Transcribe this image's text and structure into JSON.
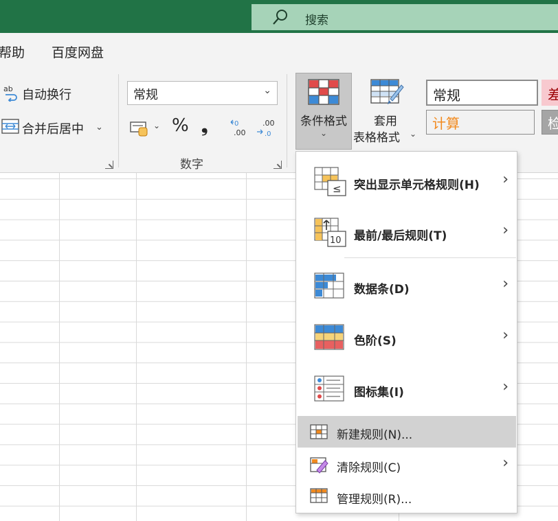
{
  "search": {
    "icon": "search-icon",
    "placeholder": "搜索"
  },
  "tabs": [
    {
      "label": "帮助"
    },
    {
      "label": "百度网盘"
    }
  ],
  "alignment": {
    "wrap_text": "自动换行",
    "merge_center": "合并后居中"
  },
  "number": {
    "format_value": "常规",
    "percent_symbol": "%",
    "comma_symbol": "❟",
    "group_label": "数字"
  },
  "styles": {
    "conditional_format": "条件格式",
    "format_as_table_line1": "套用",
    "format_as_table_line2": "表格格式",
    "cell_normal": "常规",
    "cell_bad": "差",
    "cell_calc": "计算",
    "cell_check": "检"
  },
  "menu": {
    "items": [
      {
        "label": "突出显示单元格规则(H)",
        "icon": "highlight-rules-icon",
        "has_submenu": true
      },
      {
        "label": "最前/最后规则(T)",
        "icon": "top-bottom-rules-icon",
        "has_submenu": true
      },
      {
        "label": "数据条(D)",
        "icon": "data-bars-icon",
        "has_submenu": true
      },
      {
        "label": "色阶(S)",
        "icon": "color-scales-icon",
        "has_submenu": true
      },
      {
        "label": "图标集(I)",
        "icon": "icon-sets-icon",
        "has_submenu": true
      }
    ],
    "small_items": [
      {
        "label": "新建规则(N)...",
        "icon": "new-rule-icon",
        "has_submenu": false,
        "highlighted": true
      },
      {
        "label": "清除规则(C)",
        "icon": "clear-rules-icon",
        "has_submenu": true
      },
      {
        "label": "管理规则(R)...",
        "icon": "manage-rules-icon",
        "has_submenu": false
      }
    ]
  },
  "colors": {
    "title_bar": "#217346",
    "search_bg": "#a6d3b8",
    "accent_red": "#e04a4a",
    "accent_blue": "#3d8ad6",
    "calc_orange": "#f28a1e"
  }
}
